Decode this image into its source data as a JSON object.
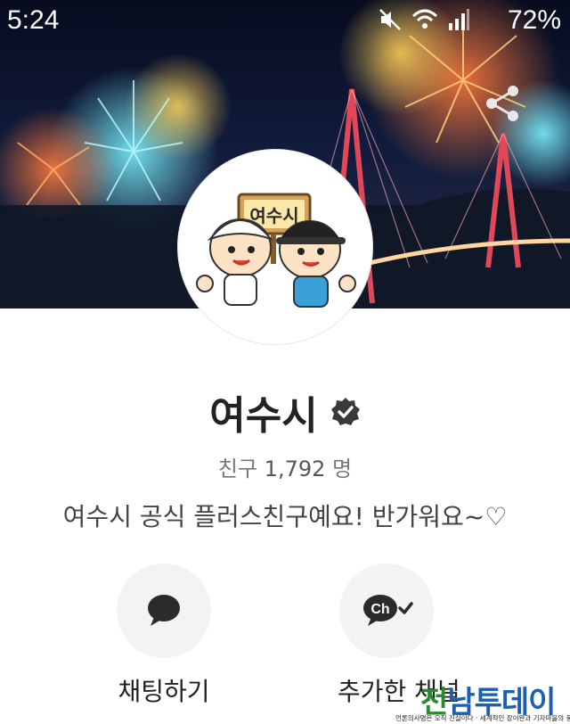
{
  "status_bar": {
    "time": "5:24",
    "battery": "72%"
  },
  "profile": {
    "avatar_sign": "여수시",
    "name": "여수시",
    "friends_label": "친구",
    "friends_count": "1,792",
    "friends_unit": "명",
    "intro": "여수시 공식 플러스친구예요! 반가워요~♡"
  },
  "actions": {
    "chat_label": "채팅하기",
    "channel_label": "추가한 채널",
    "channel_icon_text": "Ch"
  },
  "watermark": {
    "title_a": "전",
    "title_b": "남",
    "title_c": "투데이",
    "subtitle": "언론의사명은 오직 진실이다 · 세계적인 장이완과 기자마을의 풍경"
  },
  "colors": {
    "verified_badge": "#3a3a3a",
    "chat_icon": "#2b2b2b",
    "button_bg": "#f3f3f3"
  }
}
